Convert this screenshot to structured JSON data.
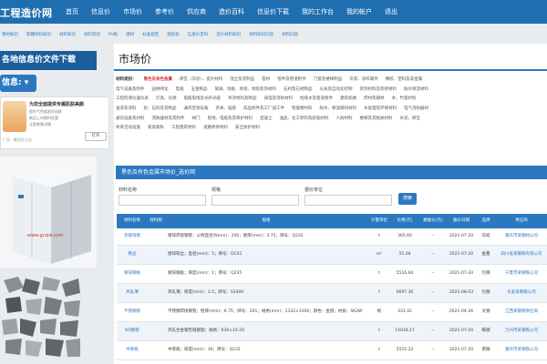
{
  "header": {
    "logo": "工程造价网",
    "nav": [
      "首页",
      "信息价",
      "市场价",
      "参考价",
      "供应商",
      "造价百科",
      "信息价下载",
      "我的工作台",
      "我的帐户",
      "退出"
    ]
  },
  "subnav": [
    "建材知识",
    "新疆材料知识",
    "材料知识",
    "材料资讯",
    "PV板",
    "建材",
    "标准规范",
    "招投标",
    "信息价百科",
    "造价材料知识",
    "材料知识问答",
    "材料问答"
  ],
  "sidebar": {
    "download_title": "各地信息价文件下载",
    "info_button": "信息: ▾",
    "ad": {
      "title": "为您全面提供专属肌肤美颜",
      "line1": "提升气色焕发好肌肤",
      "line2": "新品上市限时优惠",
      "line3": "立即查看详情",
      "open": "打开",
      "foot": "广告 · 美妆官方店"
    },
    "machine_watermark": "www.gczjw.com"
  },
  "main": {
    "title": "市场价",
    "category_rows": [
      [
        "材料类别：",
        "黑色及有色金属",
        "砖瓦（灰砂）、瓷片材料",
        "湿立及其制品",
        "管材",
        "管件及管道附件",
        "门窗及楼梯制品",
        "灰浆、涂料辅件",
        "橡胶、塑料及非金属"
      ],
      [
        "电气设备及附件",
        "园林绿化",
        "电线",
        "五金制品",
        "玻璃、地板、地毯、地毯及饰材料",
        "石材及石材制品",
        "仪表及自动化控制",
        "装饰材料及装修材料",
        "防水保温材料"
      ],
      [
        "工程检测仪器仪表",
        "灯具、光源",
        "电缆电线及光纤光缆",
        "吊顶材料及制品",
        "弱电及消防材料",
        "给排水及管道附件",
        "建筑机械",
        "焊材及辅材",
        "木、竹基材料"
      ],
      [
        "油漆及涂料",
        "砂、石料及其制品",
        "通风空调设备",
        "开关、插座",
        "成品构件及工厂加工件",
        "智能楼材料",
        "防水、保温隔热材料",
        "水处理及环保材料",
        "电气消防器材"
      ],
      [
        "通讯设备及材料",
        "消防器材及其附件",
        "阀门",
        "管线、电缆及其保护材料",
        "混凝土",
        "油品、化工原料及胶粘材料",
        "人防材料",
        "楼梯及其相关材料",
        "水泥、砖瓦"
      ],
      [
        "体育活动设施",
        "家具家私",
        "工程建筑材料",
        "道路桥梁材料",
        "安全防护材料"
      ]
    ],
    "section_title": "黑色及有色金属市场价_选价网",
    "filters": {
      "material_name_label": "材料名称",
      "region_label": "规格",
      "price_unit_label": "报价单位",
      "search_button": "搜索"
    },
    "table": {
      "headers": [
        "材料名称",
        "材料图",
        "规格",
        "计量单位",
        "价格(元)",
        "数据价(元)",
        "报价日期",
        "品牌",
        "供应商"
      ],
      "rows": [
        {
          "name": "热镀锌管",
          "spec": "镀锌焊接钢管：公称直径(Nmm)：200；壁厚(mm)：3.75；牌号：Q235",
          "unit": "t",
          "price": "365.60",
          "data_price": "--",
          "date": "2021-07-20",
          "brand": "华岐",
          "supplier": "重庆市某钢材公司"
        },
        {
          "name": "铁丝",
          "spec": "镀锌铁丝；直径(mm)：5；牌号：DC01",
          "unit": "m²",
          "price": "55.48",
          "data_price": "--",
          "date": "2021-07-20",
          "brand": "金鑫",
          "supplier": "四川省某钢铁有限公司"
        },
        {
          "name": "镀锌钢板",
          "spec": "镀锌钢板；厚度(mm)：1；牌号：Q235",
          "unit": "t",
          "price": "5516.64",
          "data_price": "--",
          "date": "2021-07-20",
          "brand": "包钢",
          "supplier": "宁夏市某钢铁公司"
        },
        {
          "name": "热轧薄",
          "spec": "热轧薄；厚度(mm)：3.5；牌号：SS400",
          "unit": "t",
          "price": "6697.36",
          "data_price": "--",
          "date": "2021-08-03",
          "brand": "包钢",
          "supplier": "乐安某钢铁公司"
        },
        {
          "name": "不锈钢管",
          "spec": "不锈钢焊接钢管；壁厚(mm)：6.75；牌号：201；规格(mm)：1332×3300；颜色：金银；材质：SK2W",
          "unit": "根",
          "price": "331.42",
          "data_price": "--",
          "date": "2021-04-26",
          "brand": "太钢",
          "supplier": "江西某钢铁供应商"
        },
        {
          "name": "ND钢管",
          "spec": "热轧合金钢无缝钢管；规格：630×10-20",
          "unit": "t",
          "price": "14018.17",
          "data_price": "--",
          "date": "2021-07-20",
          "brand": "鞍钢",
          "supplier": "万州市某钢铁公司"
        },
        {
          "name": "中厚板",
          "spec": "中厚板；厚度(mm)：30；牌号：Q235",
          "unit": "t",
          "price": "5555.23",
          "data_price": "--",
          "date": "2021-07-20",
          "brand": "南钢",
          "supplier": "重庆市某钢铁公司"
        }
      ]
    }
  },
  "colors": {
    "nav_blue": "#1f6fb0",
    "accent_blue": "#2c78c0",
    "highlight_red": "#d32f2f"
  }
}
